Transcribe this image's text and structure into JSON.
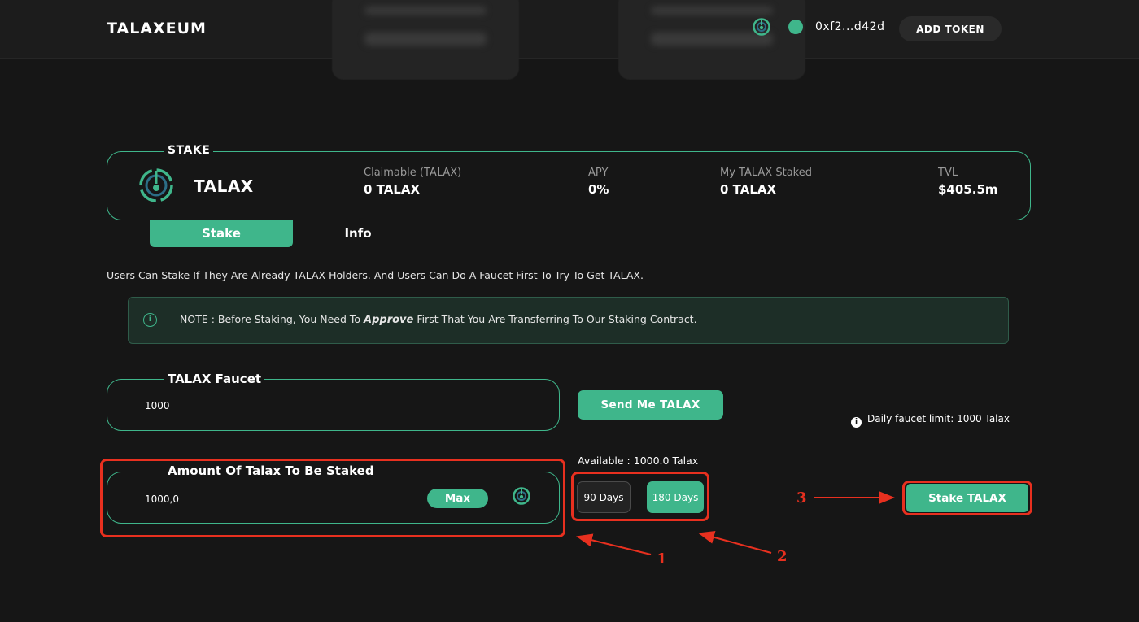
{
  "header": {
    "logo": "TALAXEUM",
    "wallet_address": "0xf2...d42d",
    "add_token_label": "ADD TOKEN"
  },
  "stake_card": {
    "section_label": "STAKE",
    "token_name": "TALAX",
    "stats": [
      {
        "label": "Claimable (TALAX)",
        "value": "0 TALAX"
      },
      {
        "label": "APY",
        "value": "0%"
      },
      {
        "label": "My TALAX Staked",
        "value": "0 TALAX"
      },
      {
        "label": "TVL",
        "value": "$405.5m"
      }
    ]
  },
  "tabs": [
    {
      "label": "Stake",
      "active": true
    },
    {
      "label": "Info",
      "active": false
    }
  ],
  "description": "Users Can Stake If They Are Already TALAX Holders. And Users Can Do A Faucet First To Try To Get TALAX.",
  "note": {
    "icon": "info-icon",
    "prefix": "NOTE : Before Staking, You Need To ",
    "emphasis": "Approve",
    "suffix": " First That You Are Transferring To Our Staking Contract."
  },
  "faucet": {
    "label": "TALAX Faucet",
    "value": "1000",
    "send_button": "Send Me TALAX",
    "limit_text": "Daily faucet limit: 1000 Talax"
  },
  "stake_amount": {
    "label": "Amount Of Talax To Be Staked",
    "value": "1000,0",
    "max_button": "Max",
    "available": "Available : 1000.0 Talax"
  },
  "durations": [
    {
      "label": "90 Days",
      "selected": false
    },
    {
      "label": "180 Days",
      "selected": true
    }
  ],
  "stake_button": "Stake TALAX",
  "annotations": [
    "1",
    "2",
    "3"
  ],
  "colors": {
    "accent": "#3fb68b",
    "background": "#161616",
    "annotation": "#e8301f"
  }
}
